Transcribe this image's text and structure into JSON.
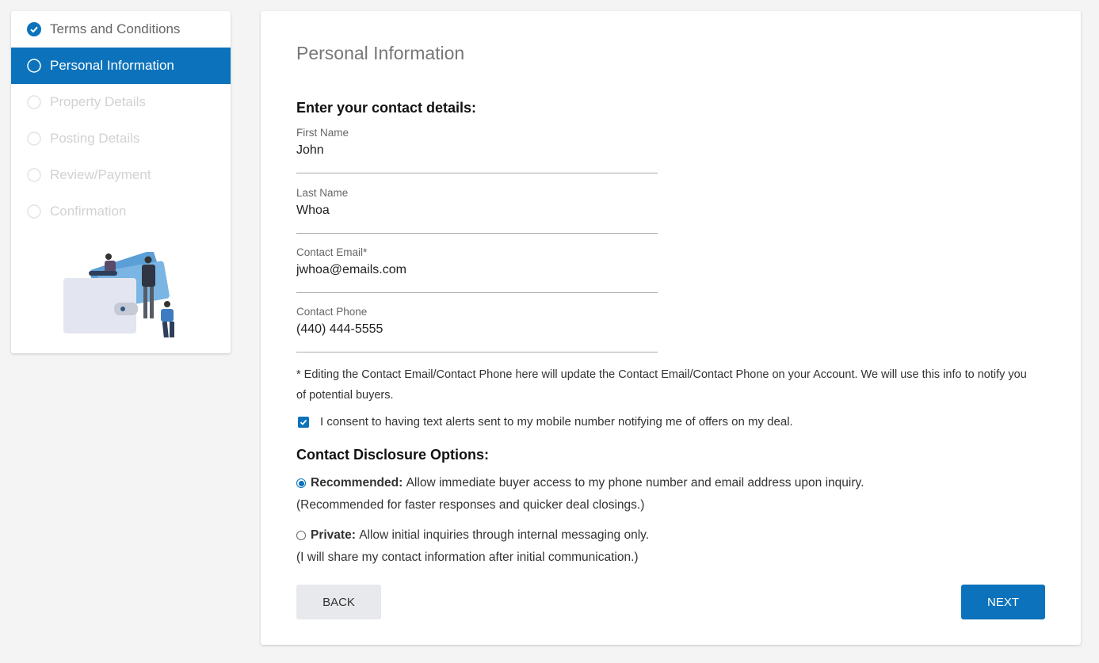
{
  "steps": [
    {
      "label": "Terms and Conditions",
      "state": "completed",
      "icon": "check-circle-icon"
    },
    {
      "label": "Personal Information",
      "state": "active",
      "icon": "circle-icon"
    },
    {
      "label": "Property Details",
      "state": "pending",
      "icon": "circle-icon"
    },
    {
      "label": "Posting Details",
      "state": "pending",
      "icon": "circle-icon"
    },
    {
      "label": "Review/Payment",
      "state": "pending",
      "icon": "circle-icon"
    },
    {
      "label": "Confirmation",
      "state": "pending",
      "icon": "circle-icon"
    }
  ],
  "form": {
    "title": "Personal Information",
    "contact_heading": "Enter your contact details:",
    "first_name": {
      "label": "First Name",
      "value": "John"
    },
    "last_name": {
      "label": "Last Name",
      "value": "Whoa"
    },
    "email": {
      "label": "Contact Email*",
      "value": "jwhoa@emails.com"
    },
    "phone": {
      "label": "Contact Phone",
      "value": "(440) 444-5555"
    },
    "note": "* Editing the Contact Email/Contact Phone here will update the Contact Email/Contact Phone on your Account. We will use this info to notify you of potential buyers.",
    "consent": {
      "label": "I consent to having text alerts sent to my mobile number notifying me of offers on my deal.",
      "checked": true
    },
    "disclosure_heading": "Contact Disclosure Options:",
    "options": [
      {
        "bold": "Recommended:",
        "text": "Allow immediate buyer access to my phone number and email address upon inquiry.",
        "sub": "(Recommended for faster responses and quicker deal closings.)",
        "selected": true
      },
      {
        "bold": "Private:",
        "text": "Allow initial inquiries through internal messaging only.",
        "sub": "(I will share my contact information after initial communication.)",
        "selected": false
      }
    ],
    "back_label": "BACK",
    "next_label": "NEXT"
  },
  "colors": {
    "primary": "#0b72bb",
    "pending": "#d2d2d2",
    "illustration": "#5b9fd6"
  }
}
